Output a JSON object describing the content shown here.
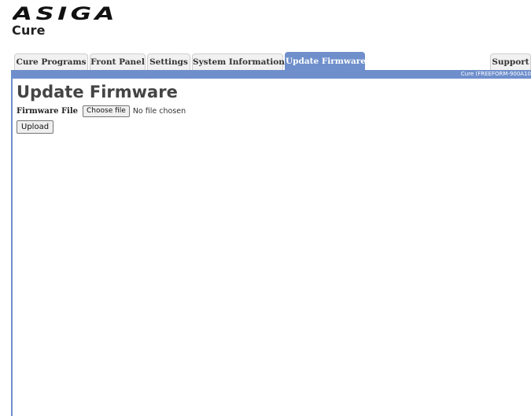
{
  "brand": {
    "logo_text": "ASIGA",
    "app_title": "Cure"
  },
  "tabs": [
    {
      "label": "Cure Programs",
      "active": false
    },
    {
      "label": "Front Panel",
      "active": false
    },
    {
      "label": "Settings",
      "active": false
    },
    {
      "label": "System Information",
      "active": false
    },
    {
      "label": "Update Firmware",
      "active": true
    }
  ],
  "support_tab": {
    "label": "Support"
  },
  "status_bar": {
    "text": "Cure (FREEFORM-900A10"
  },
  "main": {
    "heading": "Update Firmware",
    "firmware_label": "Firmware File",
    "choose_file_label": "Choose file",
    "no_file_text": "No file chosen",
    "upload_label": "Upload"
  },
  "colors": {
    "accent": "#6e8fcb",
    "tab_bg": "#f1f1f1",
    "text": "#333333"
  }
}
